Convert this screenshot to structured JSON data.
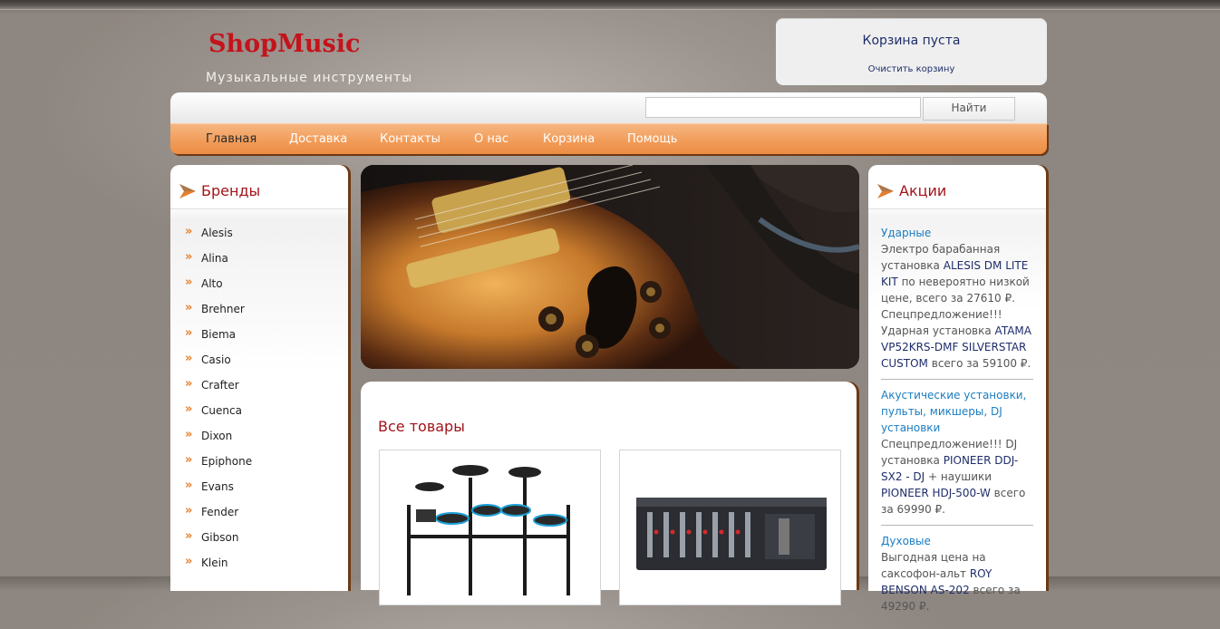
{
  "header": {
    "logo": "ShopMusic",
    "tagline": "Музыкальные инструменты"
  },
  "cart": {
    "status": "Корзина пуста",
    "clear": "Очистить корзину"
  },
  "search": {
    "value": "",
    "placeholder": "",
    "button": "Найти"
  },
  "nav": [
    "Главная",
    "Доставка",
    "Контакты",
    "О нас",
    "Корзина",
    "Помощь"
  ],
  "brands": {
    "title": "Бренды",
    "items": [
      "Alesis",
      "Alina",
      "Alto",
      "Brehner",
      "Biema",
      "Casio",
      "Crafter",
      "Cuenca",
      "Dixon",
      "Epiphone",
      "Evans",
      "Fender",
      "Gibson",
      "Klein"
    ]
  },
  "promos": {
    "title": "Акции",
    "p1": {
      "head": "Ударные",
      "t1": "Электро барабанная установка",
      "l1": "ALESIS DM LITE KIT",
      "t2": "по невероятно низкой цене, всего за 27610 ₽. Спецпредложение!!! Ударная установка",
      "l2": "ATAMA VP52KRS-DMF SILVERSTAR CUSTOM",
      "t3": "всего за 59100 ₽."
    },
    "p2": {
      "head": "Акустические установки, пульты, микшеры, DJ установки",
      "t1": "Спецпредложение!!! DJ установка",
      "l1": "PIONEER DDJ-SX2 - DJ",
      "t2": "+ наушики",
      "l2": "PIONEER HDJ-500-W",
      "t3": "всего за 69990 ₽."
    },
    "p3": {
      "head": "Духовые",
      "t1": "Выгодная цена на саксофон-альт",
      "l1": "ROY BENSON AS-202",
      "t2": "всего за 49290 ₽."
    }
  },
  "content": {
    "title": "Все товары"
  },
  "colors": {
    "accent_orange": "#f29d5a",
    "title_red": "#a1141a",
    "logo_red": "#c4131b",
    "link_blue": "#1b7dc0",
    "dark_link": "#1f2d6a"
  }
}
